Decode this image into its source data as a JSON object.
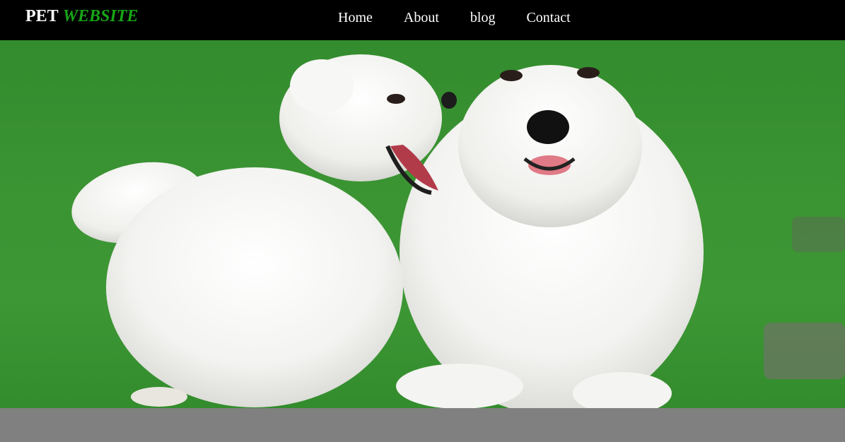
{
  "brand": {
    "part1": "PET",
    "part2": "WEBSITE",
    "accent_color": "#17a617"
  },
  "nav": {
    "items": [
      {
        "label": "Home"
      },
      {
        "label": "About"
      },
      {
        "label": "blog"
      },
      {
        "label": "Contact"
      }
    ]
  },
  "hero": {
    "image_subject": "two white samoyed dogs on grass",
    "background_color": "#3e9a35"
  },
  "colors": {
    "navbar": "#000000",
    "footer": "#808080"
  }
}
